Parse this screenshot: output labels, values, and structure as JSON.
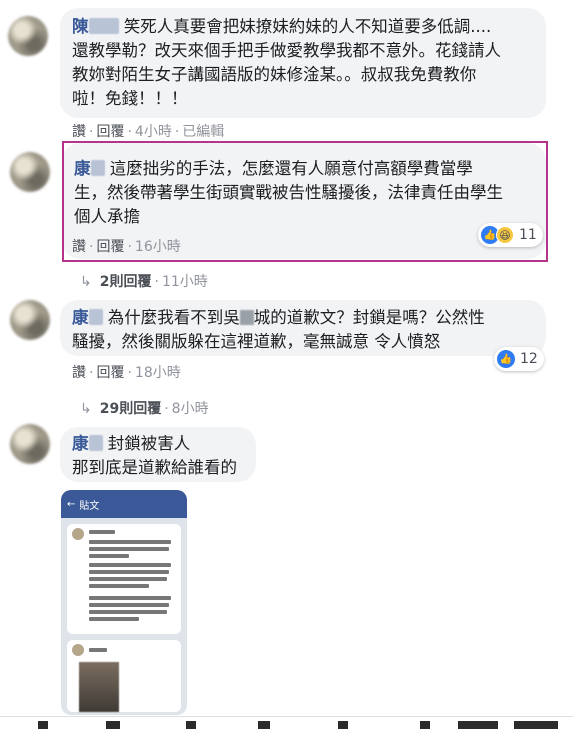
{
  "comments": [
    {
      "author": "陳",
      "text": "笑死人真要會把妹撩妹約妹的人不知道要多低調....還教學勒？改天來個手把手做愛教學我都不意外。花錢請人教妳對陌生女子講國語版的妹修淦某。。叔叔我免費教你啦！免錢！！！",
      "line1": "笑死人真要會把妹撩妹約妹的人不知道要多低調....",
      "line2": "還教學勒？改天來個手把手做愛教學我都不意外。花錢請人",
      "line3": "教妳對陌生女子講國語版的妹修淦某。。叔叔我免費教你",
      "line4": "啦！免錢！！！",
      "like": "讚",
      "reply": "回覆",
      "time": "4小時",
      "edited": "已編輯"
    },
    {
      "author": "康",
      "line1": "這麼拙劣的手法，怎麼還有人願意付高額學費當學",
      "line2": "生，然後帶著學生街頭實戰被告性騷擾後，法律責任由學生",
      "line3": "個人承擔",
      "like": "讚",
      "reply": "回覆",
      "time": "16小時",
      "reactions": "11",
      "replies_label": "2則回覆",
      "replies_time": "11小時"
    },
    {
      "author": "康",
      "line1a": "為什麼我看不到吳",
      "line1b": "城的道歉文？封鎖是嗎？公然性",
      "line2": "騷擾，然後關版躲在這裡道歉，毫無誠意 令人憤怒",
      "like": "讚",
      "reply": "回覆",
      "time": "18小時",
      "reactions": "12",
      "replies_label": "29則回覆",
      "replies_time": "8小時"
    },
    {
      "author": "康",
      "line1": "封鎖被害人",
      "line2": "那到底是道歉給誰看的",
      "embedded_header": "貼文"
    }
  ],
  "icons": {
    "like": "thumbs-up-icon",
    "haha": "haha-emoji-icon",
    "reply_arrow": "reply-arrow-icon"
  },
  "colors": {
    "author": "#385898",
    "bubble": "#f2f3f5",
    "highlight": "#b4348c",
    "like": "#2e7bf3"
  }
}
